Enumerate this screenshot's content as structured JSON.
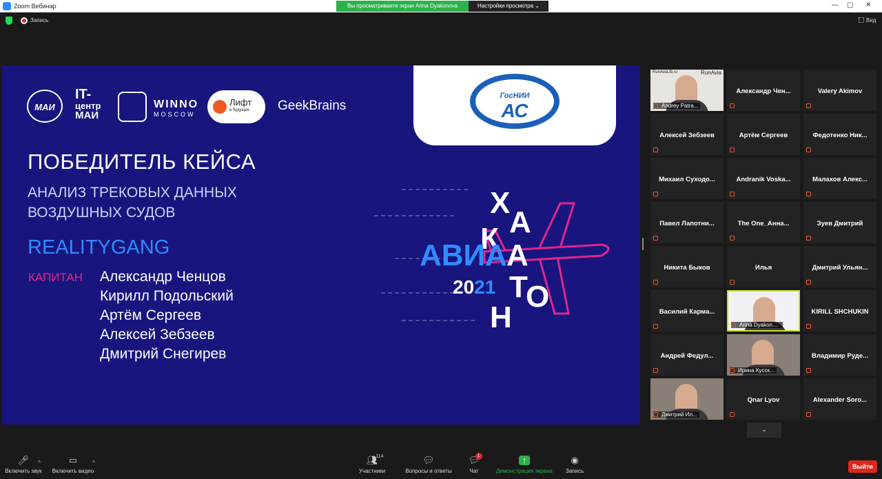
{
  "window": {
    "title": "Zoom Вебинар",
    "banner": "Вы просматриваете экран Arina Dyakonova",
    "view_settings": "Настройки просмотра ⌄",
    "controls": [
      "—",
      "▢",
      "✕"
    ]
  },
  "top_strip": {
    "record_label": "Запись",
    "view_label": "Вид"
  },
  "slide": {
    "logos": {
      "mai": "МАИ",
      "it_center": [
        "IT-",
        "центр",
        "МАИ"
      ],
      "winno": [
        "WINNO",
        "MOSCOW"
      ],
      "lift": [
        "Лифт",
        "в будущее"
      ],
      "geekbrains": "GeekBrains",
      "gosnii": [
        "ГосНИИ",
        "АС"
      ]
    },
    "title": "ПОБЕДИТЕЛЬ КЕЙСА",
    "subtitle": [
      "АНАЛИЗ ТРЕКОВЫХ ДАННЫХ",
      "ВОЗДУШНЫХ СУДОВ"
    ],
    "team_name": "REALITYGANG",
    "captain_label": "КАПИТАН",
    "members": [
      "Александр Ченцов",
      "Кирилл Подольский",
      "Артём Сергеев",
      "Алексей Зебзеев",
      "Дмитрий Снегирев"
    ],
    "hackathon": {
      "letters": [
        "Х",
        "А",
        "К",
        "А",
        "Т",
        "О",
        "Н"
      ],
      "avia": "АВИА",
      "year_a": "20",
      "year_b": "21"
    }
  },
  "gallery": {
    "tiles": [
      {
        "name": "Andrey Patra...",
        "video": true,
        "watermark": "RunAvia.tb.ru",
        "watermark2": "RunAvia"
      },
      {
        "name": "Александр  Чен..."
      },
      {
        "name": "Valery Akimov"
      },
      {
        "name": "Алексей Зебзеев"
      },
      {
        "name": "Артём Сергеев"
      },
      {
        "name": "Федотенко  Ник..."
      },
      {
        "name": "Михаил  Суходо..."
      },
      {
        "name": "Andranik  Voska..."
      },
      {
        "name": "Малахов  Алекс..."
      },
      {
        "name": "Павел  Лапотни..."
      },
      {
        "name": "The  One_Анна..."
      },
      {
        "name": "Зуев Дмитрий"
      },
      {
        "name": "Никита Быков"
      },
      {
        "name": "Илья"
      },
      {
        "name": "Дмитрий  Ульян..."
      },
      {
        "name": "Василий  Карма..."
      },
      {
        "name": "Arina Dyakonova",
        "video": true,
        "active": true
      },
      {
        "name": "KIRILL SHCHUKIN"
      },
      {
        "name": "Андрей  Федул..."
      },
      {
        "name": "Ирина Кусск...",
        "video": true
      },
      {
        "name": "Владимир  Руде..."
      },
      {
        "name": "Дмитрий Ил...",
        "video": true
      },
      {
        "name": "Qnar Lyov"
      },
      {
        "name": "Alexander  Soro..."
      }
    ],
    "more_icon": "chevron-down-icon"
  },
  "toolbar": {
    "mute": "Включить звук",
    "video": "Включить видео",
    "participants": "Участники",
    "participants_count": "114",
    "qa": "Вопросы и ответы",
    "chat": "Чат",
    "chat_badge": "1",
    "share": "Демонстрация экрана",
    "record": "Запись",
    "leave": "Выйти"
  },
  "colors": {
    "slide_bg": "#18157e",
    "accent_blue": "#2f8bff",
    "accent_pink": "#e0258e",
    "share_green": "#2db14b",
    "leave_red": "#d92a1f"
  }
}
